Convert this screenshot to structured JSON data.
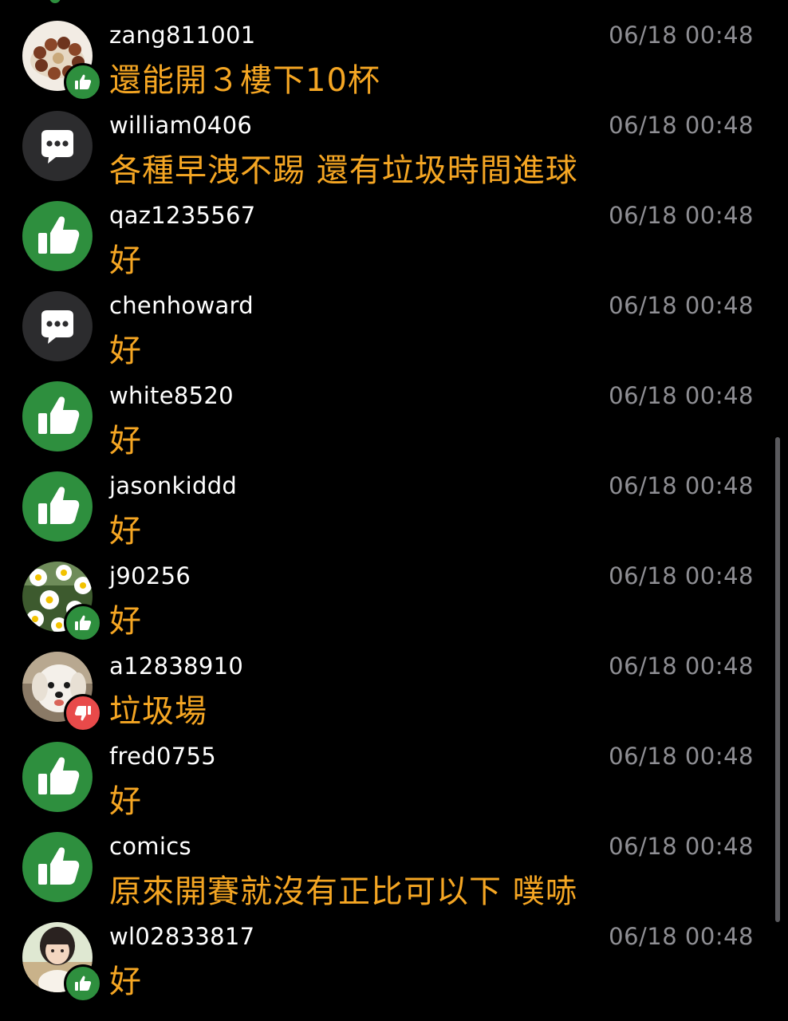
{
  "colors": {
    "background": "#000000",
    "username": "#ffffff",
    "timestamp": "#8e8e93",
    "message": "#f5a623",
    "like_green": "#2e8f3e",
    "dislike_red": "#e84a4a",
    "comment_gray": "#2c2c2e"
  },
  "comments": [
    {
      "username": "zang811001",
      "time": "06/18 00:48",
      "message": "還能開３樓下10杯",
      "avatar": "photo-beads",
      "badge": "thumbs-up-icon"
    },
    {
      "username": "william0406",
      "time": "06/18 00:48",
      "message": "各種早洩不踢 還有垃圾時間進球",
      "avatar": "chat-bubble-icon",
      "badge": ""
    },
    {
      "username": "qaz1235567",
      "time": "06/18 00:48",
      "message": "好",
      "avatar": "thumbs-up-icon",
      "badge": ""
    },
    {
      "username": "chenhoward",
      "time": "06/18 00:48",
      "message": "好",
      "avatar": "chat-bubble-icon",
      "badge": ""
    },
    {
      "username": "white8520",
      "time": "06/18 00:48",
      "message": "好",
      "avatar": "thumbs-up-icon",
      "badge": ""
    },
    {
      "username": "jasonkiddd",
      "time": "06/18 00:48",
      "message": "好",
      "avatar": "thumbs-up-icon",
      "badge": ""
    },
    {
      "username": "j90256",
      "time": "06/18 00:48",
      "message": "好",
      "avatar": "photo-daisies",
      "badge": "thumbs-up-icon"
    },
    {
      "username": "a12838910",
      "time": "06/18 00:48",
      "message": "垃圾場",
      "avatar": "photo-dog",
      "badge": "thumbs-down-icon"
    },
    {
      "username": "fred0755",
      "time": "06/18 00:48",
      "message": "好",
      "avatar": "thumbs-up-icon",
      "badge": ""
    },
    {
      "username": "comics",
      "time": "06/18 00:48",
      "message": "原來開賽就沒有正比可以下 噗哧",
      "avatar": "thumbs-up-icon",
      "badge": ""
    },
    {
      "username": "wl02833817",
      "time": "06/18 00:48",
      "message": "好",
      "avatar": "photo-person",
      "badge": "thumbs-up-icon"
    }
  ]
}
